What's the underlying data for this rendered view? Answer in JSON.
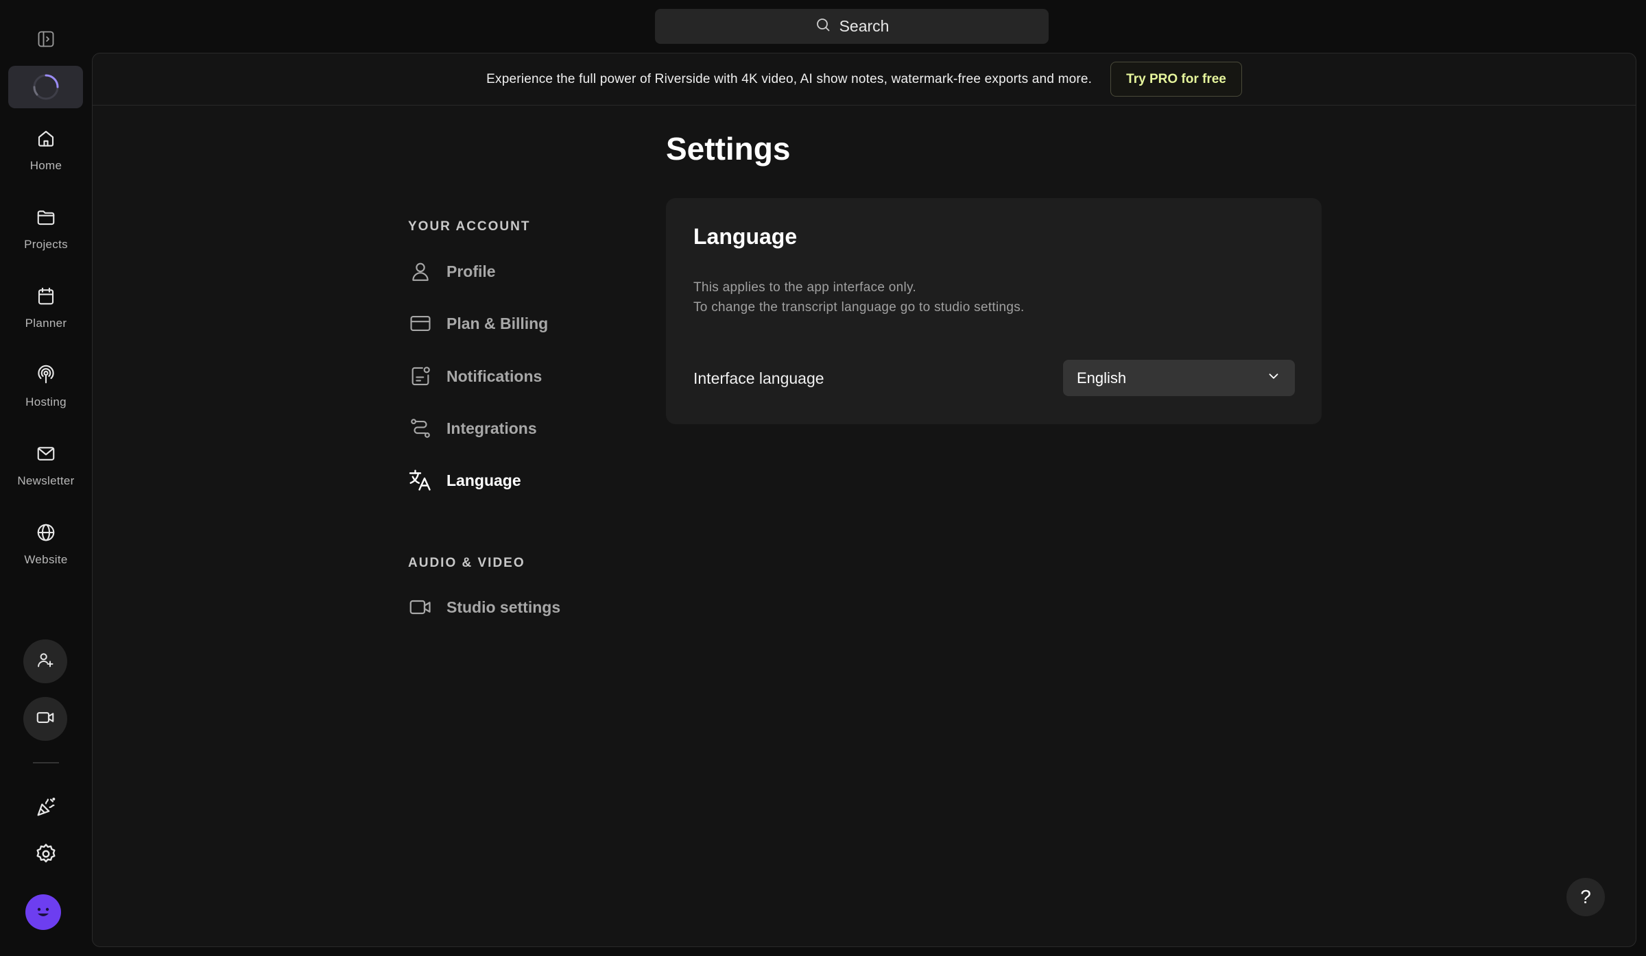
{
  "search": {
    "label": "Search"
  },
  "rail": {
    "items": [
      {
        "label": "Home",
        "icon": "home-icon"
      },
      {
        "label": "Projects",
        "icon": "folder-icon"
      },
      {
        "label": "Planner",
        "icon": "calendar-icon"
      },
      {
        "label": "Hosting",
        "icon": "podcast-icon"
      },
      {
        "label": "Newsletter",
        "icon": "mail-icon"
      },
      {
        "label": "Website",
        "icon": "globe-icon"
      }
    ]
  },
  "banner": {
    "text": "Experience the full power of Riverside with 4K video, AI show notes, watermark-free exports and more.",
    "cta": "Try PRO for free"
  },
  "page": {
    "title": "Settings"
  },
  "settings_nav": {
    "account_heading": "YOUR ACCOUNT",
    "account_items": [
      {
        "label": "Profile",
        "icon": "user-icon"
      },
      {
        "label": "Plan & Billing",
        "icon": "credit-card-icon"
      },
      {
        "label": "Notifications",
        "icon": "notification-icon"
      },
      {
        "label": "Integrations",
        "icon": "integrations-icon"
      },
      {
        "label": "Language",
        "icon": "translate-icon",
        "active": true
      }
    ],
    "av_heading": "AUDIO & VIDEO",
    "av_items": [
      {
        "label": "Studio settings",
        "icon": "video-icon"
      }
    ]
  },
  "language_card": {
    "title": "Language",
    "desc_line1": "This applies to the app interface only.",
    "desc_line2": "To change the transcript language go to studio settings.",
    "field_label": "Interface language",
    "selected": "English"
  },
  "help": {
    "label": "?"
  },
  "colors": {
    "accent_cta": "#e6f59c",
    "avatar": "#6d3ef0",
    "spinner": "#9b8cf5"
  }
}
